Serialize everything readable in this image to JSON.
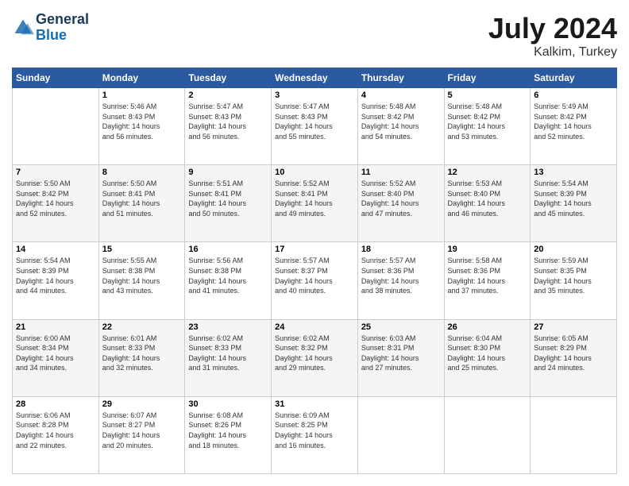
{
  "logo": {
    "line1": "General",
    "line2": "Blue"
  },
  "title": {
    "month_year": "July 2024",
    "location": "Kalkim, Turkey"
  },
  "weekdays": [
    "Sunday",
    "Monday",
    "Tuesday",
    "Wednesday",
    "Thursday",
    "Friday",
    "Saturday"
  ],
  "weeks": [
    [
      {
        "day": "",
        "info": ""
      },
      {
        "day": "1",
        "info": "Sunrise: 5:46 AM\nSunset: 8:43 PM\nDaylight: 14 hours\nand 56 minutes."
      },
      {
        "day": "2",
        "info": "Sunrise: 5:47 AM\nSunset: 8:43 PM\nDaylight: 14 hours\nand 56 minutes."
      },
      {
        "day": "3",
        "info": "Sunrise: 5:47 AM\nSunset: 8:43 PM\nDaylight: 14 hours\nand 55 minutes."
      },
      {
        "day": "4",
        "info": "Sunrise: 5:48 AM\nSunset: 8:42 PM\nDaylight: 14 hours\nand 54 minutes."
      },
      {
        "day": "5",
        "info": "Sunrise: 5:48 AM\nSunset: 8:42 PM\nDaylight: 14 hours\nand 53 minutes."
      },
      {
        "day": "6",
        "info": "Sunrise: 5:49 AM\nSunset: 8:42 PM\nDaylight: 14 hours\nand 52 minutes."
      }
    ],
    [
      {
        "day": "7",
        "info": "Sunrise: 5:50 AM\nSunset: 8:42 PM\nDaylight: 14 hours\nand 52 minutes."
      },
      {
        "day": "8",
        "info": "Sunrise: 5:50 AM\nSunset: 8:41 PM\nDaylight: 14 hours\nand 51 minutes."
      },
      {
        "day": "9",
        "info": "Sunrise: 5:51 AM\nSunset: 8:41 PM\nDaylight: 14 hours\nand 50 minutes."
      },
      {
        "day": "10",
        "info": "Sunrise: 5:52 AM\nSunset: 8:41 PM\nDaylight: 14 hours\nand 49 minutes."
      },
      {
        "day": "11",
        "info": "Sunrise: 5:52 AM\nSunset: 8:40 PM\nDaylight: 14 hours\nand 47 minutes."
      },
      {
        "day": "12",
        "info": "Sunrise: 5:53 AM\nSunset: 8:40 PM\nDaylight: 14 hours\nand 46 minutes."
      },
      {
        "day": "13",
        "info": "Sunrise: 5:54 AM\nSunset: 8:39 PM\nDaylight: 14 hours\nand 45 minutes."
      }
    ],
    [
      {
        "day": "14",
        "info": "Sunrise: 5:54 AM\nSunset: 8:39 PM\nDaylight: 14 hours\nand 44 minutes."
      },
      {
        "day": "15",
        "info": "Sunrise: 5:55 AM\nSunset: 8:38 PM\nDaylight: 14 hours\nand 43 minutes."
      },
      {
        "day": "16",
        "info": "Sunrise: 5:56 AM\nSunset: 8:38 PM\nDaylight: 14 hours\nand 41 minutes."
      },
      {
        "day": "17",
        "info": "Sunrise: 5:57 AM\nSunset: 8:37 PM\nDaylight: 14 hours\nand 40 minutes."
      },
      {
        "day": "18",
        "info": "Sunrise: 5:57 AM\nSunset: 8:36 PM\nDaylight: 14 hours\nand 38 minutes."
      },
      {
        "day": "19",
        "info": "Sunrise: 5:58 AM\nSunset: 8:36 PM\nDaylight: 14 hours\nand 37 minutes."
      },
      {
        "day": "20",
        "info": "Sunrise: 5:59 AM\nSunset: 8:35 PM\nDaylight: 14 hours\nand 35 minutes."
      }
    ],
    [
      {
        "day": "21",
        "info": "Sunrise: 6:00 AM\nSunset: 8:34 PM\nDaylight: 14 hours\nand 34 minutes."
      },
      {
        "day": "22",
        "info": "Sunrise: 6:01 AM\nSunset: 8:33 PM\nDaylight: 14 hours\nand 32 minutes."
      },
      {
        "day": "23",
        "info": "Sunrise: 6:02 AM\nSunset: 8:33 PM\nDaylight: 14 hours\nand 31 minutes."
      },
      {
        "day": "24",
        "info": "Sunrise: 6:02 AM\nSunset: 8:32 PM\nDaylight: 14 hours\nand 29 minutes."
      },
      {
        "day": "25",
        "info": "Sunrise: 6:03 AM\nSunset: 8:31 PM\nDaylight: 14 hours\nand 27 minutes."
      },
      {
        "day": "26",
        "info": "Sunrise: 6:04 AM\nSunset: 8:30 PM\nDaylight: 14 hours\nand 25 minutes."
      },
      {
        "day": "27",
        "info": "Sunrise: 6:05 AM\nSunset: 8:29 PM\nDaylight: 14 hours\nand 24 minutes."
      }
    ],
    [
      {
        "day": "28",
        "info": "Sunrise: 6:06 AM\nSunset: 8:28 PM\nDaylight: 14 hours\nand 22 minutes."
      },
      {
        "day": "29",
        "info": "Sunrise: 6:07 AM\nSunset: 8:27 PM\nDaylight: 14 hours\nand 20 minutes."
      },
      {
        "day": "30",
        "info": "Sunrise: 6:08 AM\nSunset: 8:26 PM\nDaylight: 14 hours\nand 18 minutes."
      },
      {
        "day": "31",
        "info": "Sunrise: 6:09 AM\nSunset: 8:25 PM\nDaylight: 14 hours\nand 16 minutes."
      },
      {
        "day": "",
        "info": ""
      },
      {
        "day": "",
        "info": ""
      },
      {
        "day": "",
        "info": ""
      }
    ]
  ]
}
